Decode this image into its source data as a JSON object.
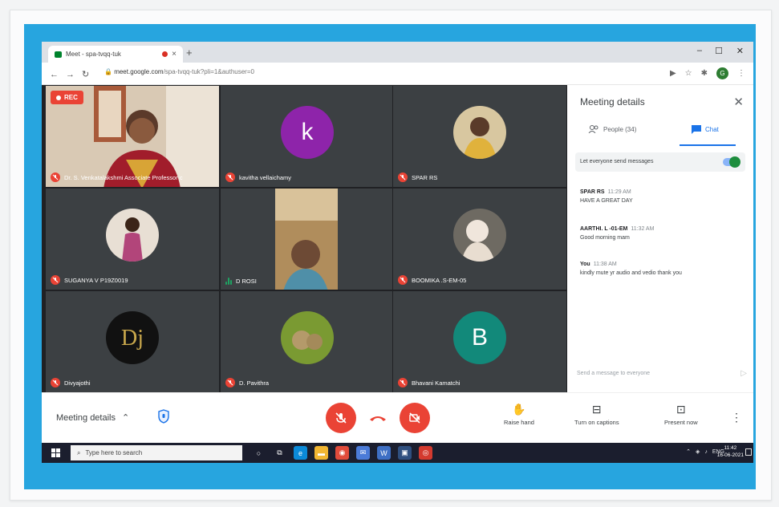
{
  "browser": {
    "tab_title": "Meet - spa-tvqq-tuk",
    "url_host": "meet.google.com",
    "url_path": "/spa-tvqq-tuk?pli=1&authuser=0",
    "profile_initial": "G"
  },
  "recording_badge": "REC",
  "participants": [
    {
      "name": "Dr. S. Venkatalakshmi Associate Professor c",
      "avatar_type": "video",
      "mic": "off"
    },
    {
      "name": "kavitha vellaichamy",
      "avatar_type": "letter",
      "letter": "k",
      "color": "#8e24aa",
      "mic": "off"
    },
    {
      "name": "SPAR RS",
      "avatar_type": "photo",
      "color": "#c8a04a",
      "mic": "off"
    },
    {
      "name": "SUGANYA V P19Z0019",
      "avatar_type": "photo",
      "color": "#b86d8a",
      "mic": "off"
    },
    {
      "name": "D ROSI",
      "avatar_type": "video",
      "mic": "speaking"
    },
    {
      "name": "BOOMIKA .S-EM-05",
      "avatar_type": "photo",
      "color": "#cdbfa8",
      "mic": "off"
    },
    {
      "name": "Divyajothi",
      "avatar_type": "photo",
      "color": "#1a1a1a",
      "mic": "off"
    },
    {
      "name": "D. Pavithra",
      "avatar_type": "photo",
      "color": "#6b8e23",
      "mic": "off"
    },
    {
      "name": "Bhavani Kamatchi",
      "avatar_type": "letter",
      "letter": "B",
      "color": "#12897a",
      "mic": "off"
    }
  ],
  "panel": {
    "title": "Meeting details",
    "people_tab": "People (34)",
    "chat_tab": "Chat",
    "setting_label": "Let everyone send messages",
    "messages": [
      {
        "sender": "SPAR RS",
        "time": "11:29 AM",
        "text": "HAVE A GREAT DAY"
      },
      {
        "sender": "AARTHI. L -01-EM",
        "time": "11:32 AM",
        "text": "Good morning mam"
      },
      {
        "sender": "You",
        "time": "11:38 AM",
        "text": "kindly mute yr audio and vedio thank you"
      }
    ],
    "send_placeholder": "Send a message to everyone"
  },
  "bottombar": {
    "meeting_details": "Meeting details",
    "raise_hand": "Raise hand",
    "captions": "Turn on captions",
    "present": "Present now"
  },
  "taskbar": {
    "search_placeholder": "Type here to search",
    "lang": "ENG",
    "time": "11:42",
    "date": "16-06-2021"
  }
}
